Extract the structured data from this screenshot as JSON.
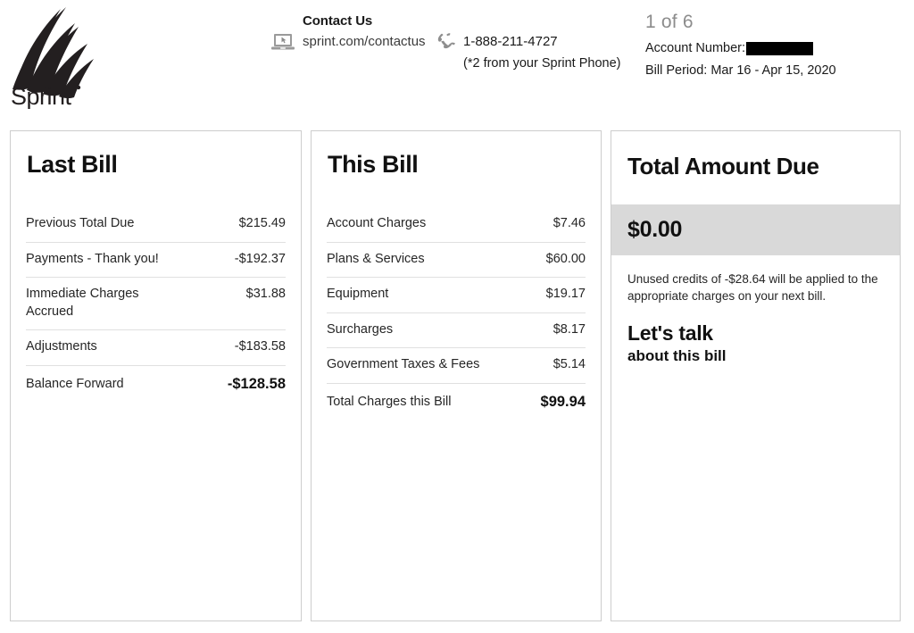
{
  "header": {
    "logo_text": "Sprint",
    "logo_icon": "sprint-wing-logo",
    "contact": {
      "icon": "laptop-icon",
      "title": "Contact Us",
      "url": "sprint.com/contactus"
    },
    "phone": {
      "icon": "phone-handset-icon",
      "number": "1-888-211-4727",
      "note": "(*2 from your Sprint Phone)"
    },
    "account": {
      "page_count": "1 of 6",
      "account_number_label": "Account Number:",
      "account_number_value": "",
      "bill_period": "Bill Period: Mar 16 - Apr 15, 2020"
    }
  },
  "cards": {
    "last_bill": {
      "title": "Last Bill",
      "rows": [
        {
          "label": "Previous Total Due",
          "value": "$215.49"
        },
        {
          "label": "Payments - Thank you!",
          "value": "-$192.37"
        },
        {
          "label": "Immediate Charges Accrued",
          "value": "$31.88"
        },
        {
          "label": "Adjustments",
          "value": "-$183.58"
        }
      ],
      "total": {
        "label": "Balance Forward",
        "value": "-$128.58"
      }
    },
    "this_bill": {
      "title": "This Bill",
      "rows": [
        {
          "label": "Account Charges",
          "value": "$7.46"
        },
        {
          "label": "Plans & Services",
          "value": "$60.00"
        },
        {
          "label": "Equipment",
          "value": "$19.17"
        },
        {
          "label": "Surcharges",
          "value": "$8.17"
        },
        {
          "label": "Government Taxes & Fees",
          "value": "$5.14"
        }
      ],
      "total": {
        "label": "Total Charges this Bill",
        "value": "$99.94"
      }
    },
    "total_due": {
      "title": "Total Amount Due",
      "amount": "$0.00",
      "credit_note": "Unused credits of -$28.64 will be applied to the appropriate charges on your next bill.",
      "lets_talk": "Let's talk",
      "about_bill": "about this bill"
    }
  },
  "colors": {
    "band_gray": "#d9d9d9",
    "card_border": "#cdcdcd",
    "page_count_gray": "#8c8c8c",
    "redaction_black": "#000000"
  }
}
